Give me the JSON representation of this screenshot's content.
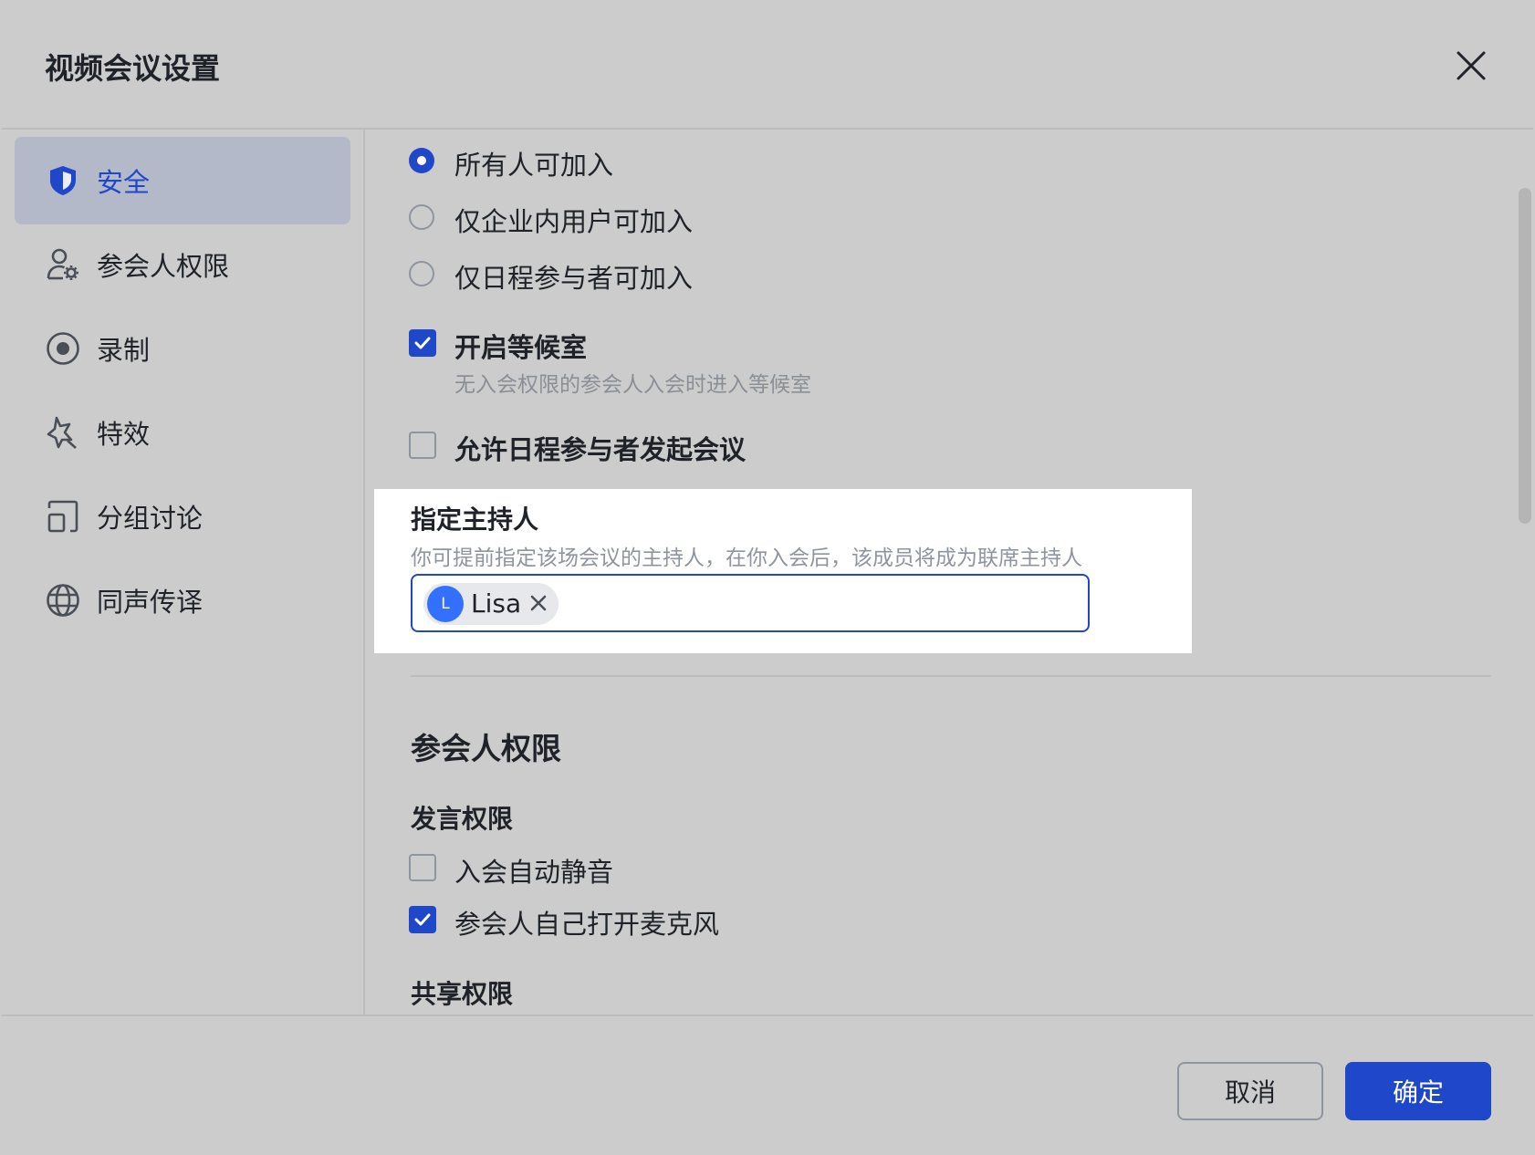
{
  "dialog": {
    "title": "视频会议设置"
  },
  "sidebar": {
    "items": [
      {
        "label": "安全",
        "icon": "shield-icon",
        "active": true
      },
      {
        "label": "参会人权限",
        "icon": "user-settings-icon",
        "active": false
      },
      {
        "label": "录制",
        "icon": "record-icon",
        "active": false
      },
      {
        "label": "特效",
        "icon": "sparkle-icon",
        "active": false
      },
      {
        "label": "分组讨论",
        "icon": "breakout-icon",
        "active": false
      },
      {
        "label": "同声传译",
        "icon": "globe-icon",
        "active": false
      }
    ]
  },
  "security": {
    "join_options": [
      {
        "label": "所有人可加入",
        "checked": true
      },
      {
        "label": "仅企业内用户可加入",
        "checked": false
      },
      {
        "label": "仅日程参与者可加入",
        "checked": false
      }
    ],
    "waiting_room": {
      "label": "开启等候室",
      "description": "无入会权限的参会人入会时进入等候室",
      "checked": true
    },
    "allow_start": {
      "label": "允许日程参与者发起会议",
      "checked": false
    },
    "host": {
      "title": "指定主持人",
      "description": "你可提前指定该场会议的主持人，在你入会后，该成员将成为联席主持人",
      "chip": {
        "initial": "L",
        "name": "Lisa"
      }
    }
  },
  "participant_permissions": {
    "title": "参会人权限",
    "speaking": {
      "title": "发言权限",
      "options": [
        {
          "label": "入会自动静音",
          "checked": false
        },
        {
          "label": "参会人自己打开麦克风",
          "checked": true
        }
      ]
    },
    "sharing": {
      "title": "共享权限"
    }
  },
  "footer": {
    "cancel_label": "取消",
    "ok_label": "确定"
  },
  "colors": {
    "accent": "#1f47c9",
    "avatar": "#3370ff",
    "overlay_bg": "#cccccc"
  }
}
